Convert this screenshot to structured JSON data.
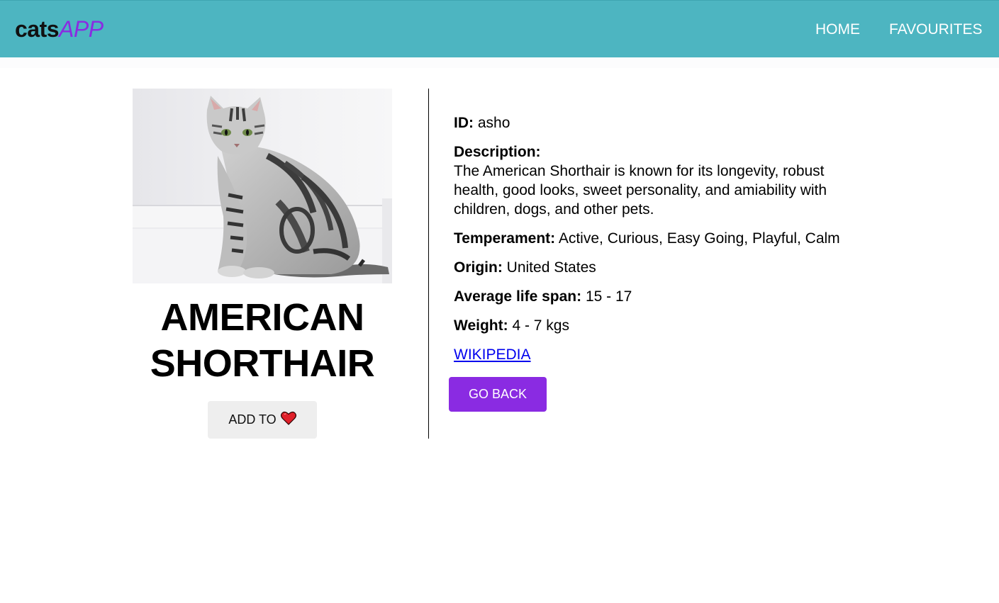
{
  "navbar": {
    "brand_bold": "cats",
    "brand_italic": "APP",
    "links": [
      {
        "label": "HOME"
      },
      {
        "label": "FAVOURITES"
      }
    ]
  },
  "breed": {
    "name": "AMERICAN SHORTHAIR",
    "add_button_label": "ADD TO",
    "add_button_icon": "heart-icon"
  },
  "details": {
    "id_label": "ID:",
    "id_value": "asho",
    "description_label": "Description:",
    "description_value": "The American Shorthair is known for its longevity, robust health, good looks, sweet personality, and amiability with children, dogs, and other pets.",
    "temperament_label": "Temperament:",
    "temperament_value": "Active, Curious, Easy Going, Playful, Calm",
    "origin_label": "Origin:",
    "origin_value": "United States",
    "lifespan_label": "Average life span:",
    "lifespan_value": "15 - 17",
    "weight_label": "Weight:",
    "weight_value": "4 - 7 kgs",
    "wiki_link_label": "WIKIPEDIA"
  },
  "actions": {
    "back_label": "GO BACK"
  },
  "colors": {
    "navbar": "#4db5c1",
    "accent_purple": "#8a2be2",
    "heart": "#e0202a",
    "link": "#0000ee"
  }
}
